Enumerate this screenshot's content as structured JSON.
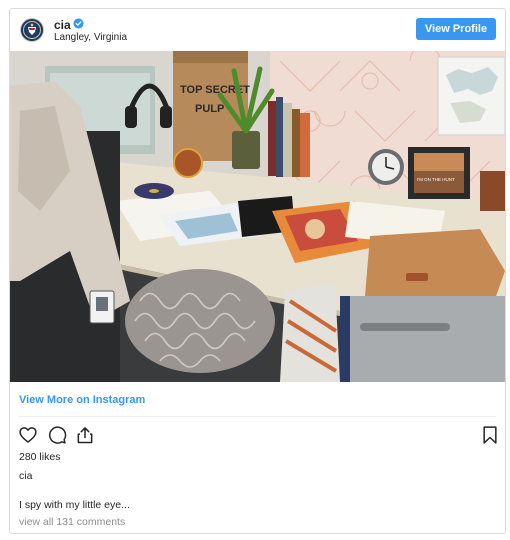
{
  "post": {
    "username": "cia",
    "location": "Langley, Virginia",
    "view_profile_label": "View Profile",
    "view_more_label": "View More on Instagram",
    "likes": "280 likes",
    "caption_username": "cia",
    "caption_text": "I spy with my little eye...",
    "comments_link": "view all 131 comments"
  },
  "photo": {
    "bag_label_line1": "TOP SECRET",
    "bag_label_line2": "PULP",
    "desk_note": "I'M ON THE HUNT"
  },
  "icons": {
    "verified": "verified-badge-icon",
    "like": "heart-icon",
    "comment": "comment-icon",
    "share": "share-icon",
    "save": "bookmark-icon"
  },
  "colors": {
    "accent": "#3897f0",
    "text": "#262626",
    "muted": "#8e8e8e",
    "border": "#dbdbdb"
  }
}
